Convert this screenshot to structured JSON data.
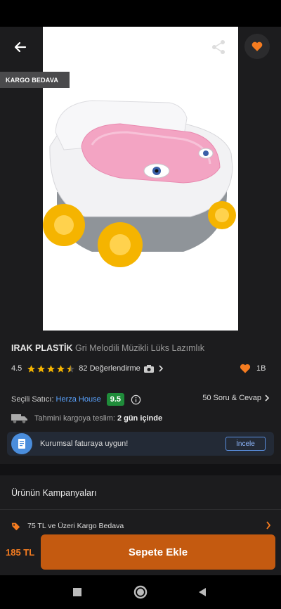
{
  "hero": {
    "badge": "KARGO BEDAVA",
    "image": "pink-potty-product-photo"
  },
  "product": {
    "brand": "IRAK PLASTİK",
    "name": "Gri Melodili Müzikli Lüks Lazımlık",
    "rating": "4.5",
    "rating_value": 4.5,
    "review_count": "82 Değerlendirme",
    "likes": "1B"
  },
  "seller": {
    "label": "Seçili Satıcı:",
    "name": "Herza House",
    "score": "9.5",
    "qa": "50 Soru & Cevap"
  },
  "delivery": {
    "label": "Tahmini kargoya teslim:",
    "value": "2 gün içinde"
  },
  "invoice": {
    "text": "Kurumsal faturaya uygun!",
    "button": "İncele"
  },
  "campaigns": {
    "title": "Ürünün Kampanyaları",
    "items": [
      {
        "label": "75 TL ve Üzeri Kargo Bedava"
      }
    ]
  },
  "bottom": {
    "price": "185 TL",
    "button": "Sepete Ekle"
  },
  "colors": {
    "accent": "#f57c20",
    "cart_button": "#c45a10",
    "seller_link": "#5aa3ff",
    "score_badge": "#1f8c3a",
    "invoice_icon": "#4a8ddc"
  }
}
